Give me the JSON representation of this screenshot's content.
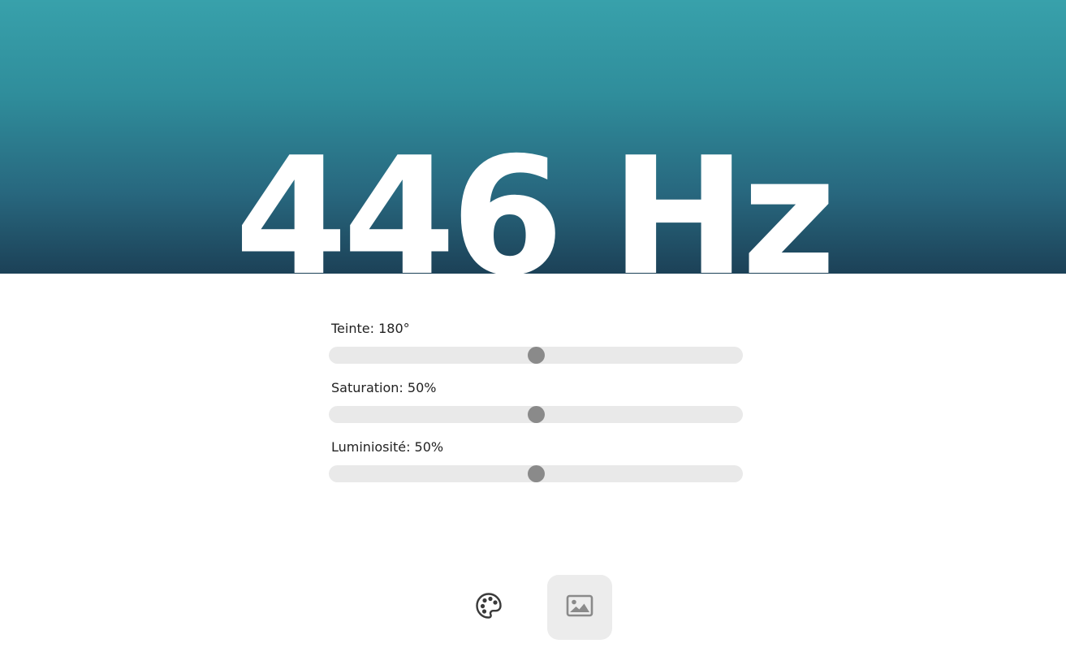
{
  "hero": {
    "frequency_text": "446 Hz"
  },
  "sliders": [
    {
      "label": "Teinte: 180°",
      "value_fraction": 0.5
    },
    {
      "label": "Saturation: 50%",
      "value_fraction": 0.5
    },
    {
      "label": "Luminiosité: 50%",
      "value_fraction": 0.5
    }
  ],
  "colors": {
    "gradient_top": "#38a1ab",
    "gradient_bottom": "#1c4157",
    "track": "#e9e9e9",
    "thumb": "#8a8a8a",
    "active_button_bg": "#ececec"
  },
  "toolbar": {
    "palette_icon": "palette-icon",
    "image_icon": "image-icon",
    "active": "image"
  }
}
